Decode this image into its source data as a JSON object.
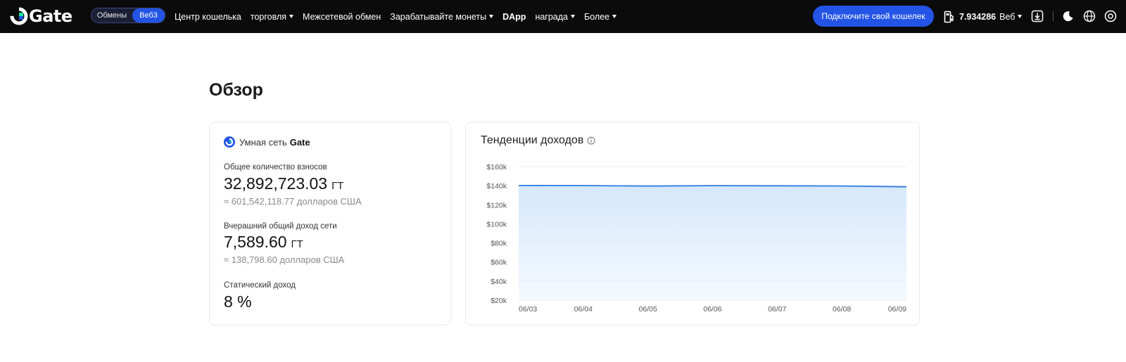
{
  "header": {
    "logo_text": "Gate",
    "switch": {
      "option1": "Обмены",
      "option2": "Веб3"
    },
    "nav": [
      {
        "label": "Центр кошелька",
        "caret": false,
        "bold": false
      },
      {
        "label": "торговля",
        "caret": true,
        "bold": false
      },
      {
        "label": "Межсетевой обмен",
        "caret": false,
        "bold": false
      },
      {
        "label": "Зарабатывайте монеты",
        "caret": true,
        "bold": false
      },
      {
        "label": "DApp",
        "caret": false,
        "bold": true
      },
      {
        "label": "награда",
        "caret": true,
        "bold": false
      },
      {
        "label": "Более",
        "caret": true,
        "bold": false
      }
    ],
    "connect_label": "Подключите свой кошелек",
    "gas_value": "7.934286",
    "gas_unit": "Веб",
    "icons": [
      "gas-pump-icon",
      "download-icon",
      "moon-icon",
      "globe-icon",
      "settings-icon"
    ],
    "accent": "#2354e6"
  },
  "overview": {
    "title": "Обзор",
    "network_prefix": "Умная сеть",
    "network_name": "Gate",
    "stats": [
      {
        "label": "Общее количество взносов",
        "value": "32,892,723.03",
        "unit": "ГТ",
        "sub": "≈ 601,542,118.77 долларов США"
      },
      {
        "label": "Вчерашний общий доход сети",
        "value": "7,589.60",
        "unit": "ГТ",
        "sub": "≈ 138,798.60 долларов США"
      },
      {
        "label": "Статический доход",
        "value": "8 %",
        "unit": "",
        "sub": ""
      }
    ]
  },
  "chart_panel": {
    "title": "Тенденции доходов"
  },
  "chart_data": {
    "type": "area",
    "categories": [
      "06/03",
      "06/04",
      "06/05",
      "06/06",
      "06/07",
      "06/08",
      "06/09"
    ],
    "yticks": [
      "$20k",
      "$40k",
      "$60k",
      "$80k",
      "$100k",
      "$120k",
      "$140k",
      "$160k"
    ],
    "ylim": [
      20000,
      160000
    ],
    "series": [
      {
        "values": [
          140200,
          140100,
          139600,
          140000,
          139900,
          139700,
          138800
        ]
      }
    ],
    "line_color": "#2f7de1",
    "fill_color": "#d6e8fb",
    "grid": true
  }
}
